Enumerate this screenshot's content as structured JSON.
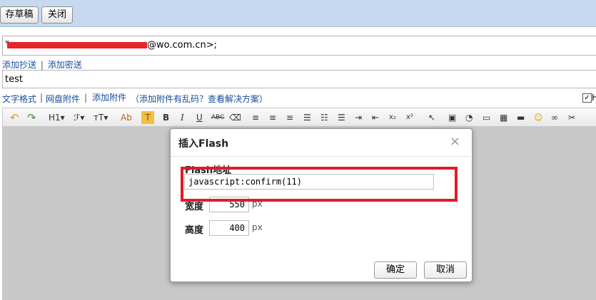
{
  "topbar": {
    "save_draft": "存草稿",
    "close": "关闭"
  },
  "recipient": {
    "prefix": "\"",
    "suffix": "@wo.com.cn>;"
  },
  "links": {
    "add_cc": "添加抄送",
    "separator": "|",
    "add_bcc": "添加密送"
  },
  "subject": {
    "value": "test"
  },
  "attach_bar": {
    "text_format": "文字格式",
    "sep1": "|",
    "netdisk": "网盘附件",
    "sep2": "|",
    "add_attachment": "添加附件",
    "garbled_hint": "（添加附件有乱码？查看解决方案）",
    "right_checkbox_label": "H"
  },
  "toolbar": {
    "h1": "H1▾",
    "font": "ℱ▾",
    "size": "тT▾",
    "ab": "Ab",
    "t_highlight": "T",
    "bold": "B",
    "italic": "I",
    "underline": "U",
    "strike": "ABC",
    "sub": "x₂",
    "sup": "x²"
  },
  "dialog": {
    "title": "插入Flash",
    "close_symbol": "×",
    "url_label": "Flash地址",
    "url_value": "javascript:confirm(11)",
    "width_label": "宽度",
    "width_value": "550",
    "height_label": "高度",
    "height_value": "400",
    "unit": "px",
    "ok": "确定",
    "cancel": "取消"
  },
  "colors": {
    "topbar": "#c6d9f1",
    "highlight": "#e01b24",
    "link": "#1a4c9c",
    "editor_bg": "#c8c8c8"
  }
}
